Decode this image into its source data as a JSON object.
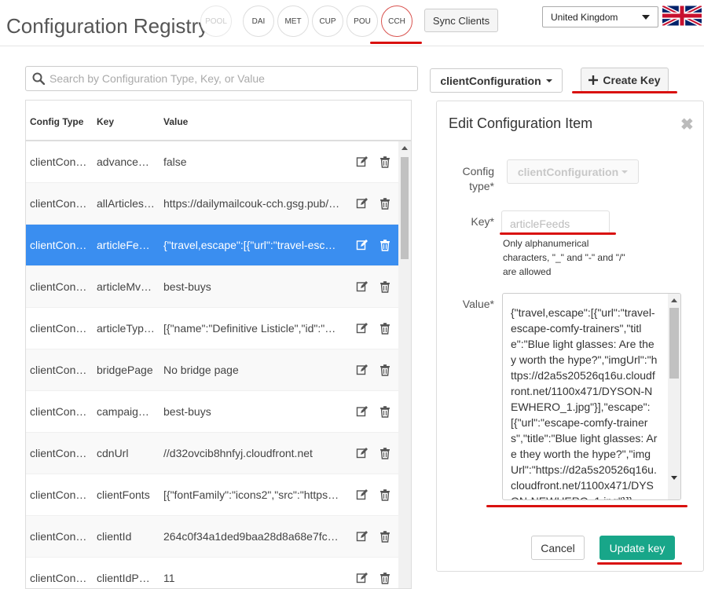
{
  "header": {
    "title": "Configuration Registry",
    "environments": [
      {
        "label": "POOL",
        "state": "disabled"
      },
      {
        "label": "DAI",
        "state": "normal"
      },
      {
        "label": "MET",
        "state": "normal"
      },
      {
        "label": "CUP",
        "state": "normal"
      },
      {
        "label": "POU",
        "state": "normal"
      },
      {
        "label": "CCH",
        "state": "active"
      }
    ],
    "sync_label": "Sync Clients",
    "country": "United Kingdom",
    "flag_icon": "uk-flag-icon"
  },
  "search": {
    "placeholder": "Search by Configuration Type, Key, or Value"
  },
  "toolbar": {
    "type_selected": "clientConfiguration",
    "create_label": "Create Key"
  },
  "table": {
    "headers": [
      "Config Type",
      "Key",
      "Value"
    ],
    "rows": [
      {
        "type": "clientCon…",
        "key": "advance…",
        "value": "false"
      },
      {
        "type": "clientCon…",
        "key": "allArticles…",
        "value": "https://dailymailcouk-cch.gsg.pub/…"
      },
      {
        "type": "clientCon…",
        "key": "articleFe…",
        "value": "{\"travel,escape\":[{\"url\":\"travel-esc…",
        "selected": true
      },
      {
        "type": "clientCon…",
        "key": "articleMv…",
        "value": "best-buys"
      },
      {
        "type": "clientCon…",
        "key": "articleTyp…",
        "value": "[{\"name\":\"Definitive Listicle\",\"id\":\"…"
      },
      {
        "type": "clientCon…",
        "key": "bridgePage",
        "value": "No bridge page"
      },
      {
        "type": "clientCon…",
        "key": "campaig…",
        "value": "best-buys"
      },
      {
        "type": "clientCon…",
        "key": "cdnUrl",
        "value": "//d32ovcib8hnfyj.cloudfront.net"
      },
      {
        "type": "clientCon…",
        "key": "clientFonts",
        "value": "[{\"fontFamily\":\"icons2\",\"src\":\"https…"
      },
      {
        "type": "clientCon…",
        "key": "clientId",
        "value": "264c0f34a1ded9baa28d8a68e7fcf…"
      },
      {
        "type": "clientCon…",
        "key": "clientIdP…",
        "value": "11"
      }
    ]
  },
  "edit_panel": {
    "title": "Edit Configuration Item",
    "close_glyph": "✖",
    "config_type_label": "Config type*",
    "config_type_value": "clientConfiguration",
    "key_label": "Key*",
    "key_placeholder": "articleFeeds",
    "key_help": "Only alphanumerical characters, \"_\" and \"-\" and \"/\" are allowed",
    "value_label": "Value*",
    "value_text": "{\"travel,escape\":[{\"url\":\"travel-escape-comfy-trainers\",\"title\":\"Blue light glasses: Are they worth the hype?\",\"imgUrl\":\"https://d2a5s20526q16u.cloudfront.net/1100x471/DYSON-NEWHERO_1.jpg\"}],\"escape\":[{\"url\":\"escape-comfy-trainers\",\"title\":\"Blue light glasses: Are they worth the hype?\",\"imgUrl\":\"https://d2a5s20526q16u.cloudfront.net/1100x471/DYSON-NEWHERO_1.jpg\"}]}",
    "cancel_label": "Cancel",
    "update_label": "Update key"
  },
  "colors": {
    "selected_row": "#3a8ef0",
    "update_button": "#18a689",
    "annotation_red": "#d9110f"
  }
}
